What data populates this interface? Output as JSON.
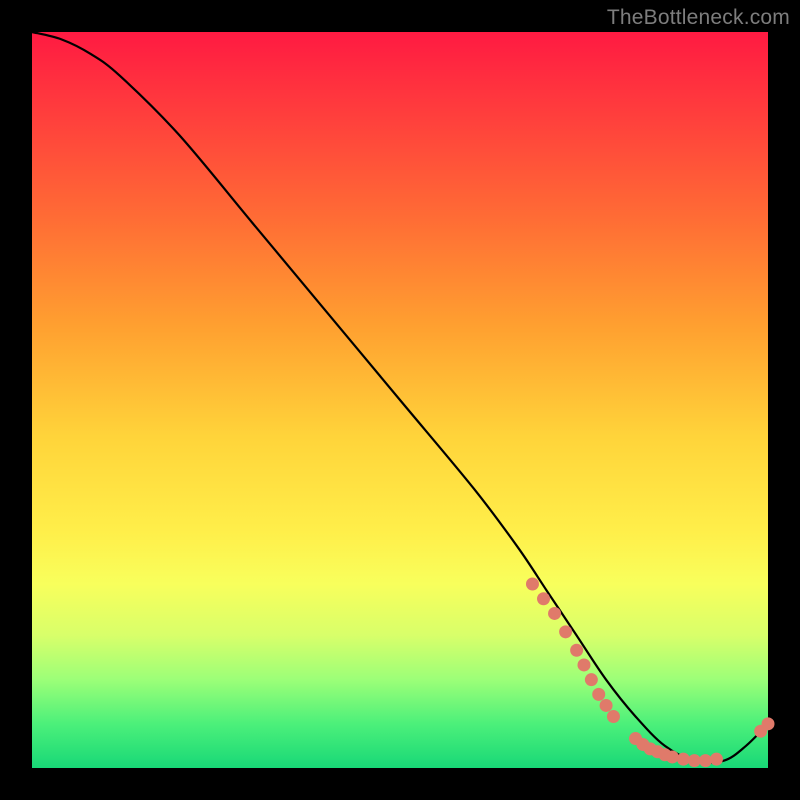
{
  "watermark": "TheBottleneck.com",
  "chart_data": {
    "type": "line",
    "title": "",
    "xlabel": "",
    "ylabel": "",
    "xlim": [
      0,
      100
    ],
    "ylim": [
      0,
      100
    ],
    "curve": {
      "name": "bottleneck-curve",
      "x": [
        0,
        4,
        8,
        12,
        20,
        30,
        40,
        50,
        60,
        66,
        70,
        74,
        78,
        82,
        86,
        90,
        94,
        97,
        100
      ],
      "y": [
        100,
        99,
        97,
        94,
        86,
        74,
        62,
        50,
        38,
        30,
        24,
        18,
        12,
        7,
        3,
        1,
        1,
        3,
        6
      ]
    },
    "markers": {
      "name": "highlight-points",
      "color": "#e07a6a",
      "points": [
        {
          "x": 68.0,
          "y": 25.0
        },
        {
          "x": 69.5,
          "y": 23.0
        },
        {
          "x": 71.0,
          "y": 21.0
        },
        {
          "x": 72.5,
          "y": 18.5
        },
        {
          "x": 74.0,
          "y": 16.0
        },
        {
          "x": 75.0,
          "y": 14.0
        },
        {
          "x": 76.0,
          "y": 12.0
        },
        {
          "x": 77.0,
          "y": 10.0
        },
        {
          "x": 78.0,
          "y": 8.5
        },
        {
          "x": 79.0,
          "y": 7.0
        },
        {
          "x": 82.0,
          "y": 4.0
        },
        {
          "x": 83.0,
          "y": 3.2
        },
        {
          "x": 84.0,
          "y": 2.6
        },
        {
          "x": 85.0,
          "y": 2.2
        },
        {
          "x": 86.0,
          "y": 1.8
        },
        {
          "x": 87.0,
          "y": 1.5
        },
        {
          "x": 88.5,
          "y": 1.2
        },
        {
          "x": 90.0,
          "y": 1.0
        },
        {
          "x": 91.5,
          "y": 1.0
        },
        {
          "x": 93.0,
          "y": 1.2
        },
        {
          "x": 99.0,
          "y": 5.0
        },
        {
          "x": 100.0,
          "y": 6.0
        }
      ]
    }
  }
}
